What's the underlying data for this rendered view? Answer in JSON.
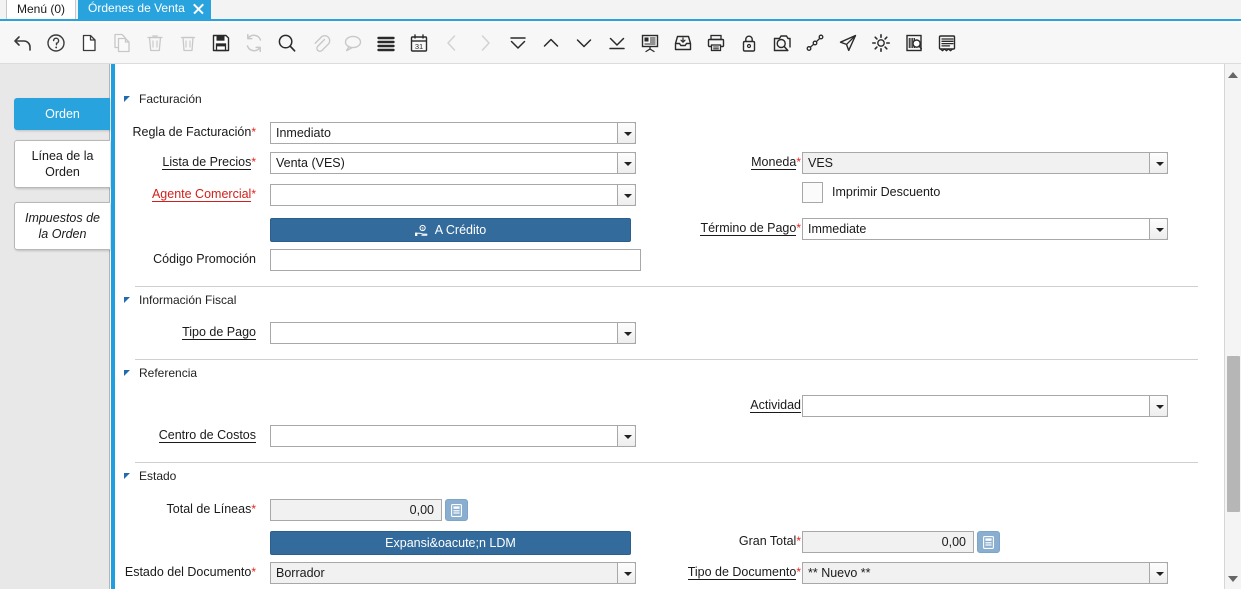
{
  "window": {
    "tabs": [
      {
        "label": "Menú (0)",
        "active": false,
        "closable": false
      },
      {
        "label": "Órdenes de Venta",
        "active": true,
        "closable": true
      }
    ]
  },
  "toolbar": {
    "items": [
      {
        "name": "undo-icon",
        "label": "Deshacer",
        "disabled": false
      },
      {
        "name": "help-icon",
        "label": "Ayuda",
        "disabled": false
      },
      {
        "name": "new-record-icon",
        "label": "Nuevo Registro",
        "disabled": false
      },
      {
        "name": "copy-record-icon",
        "label": "Copiar Registro",
        "disabled": true
      },
      {
        "name": "delete-record-icon",
        "label": "Eliminar Registro",
        "disabled": true
      },
      {
        "name": "delete-selection-icon",
        "label": "Eliminar Selección",
        "disabled": true
      },
      {
        "name": "save-icon",
        "label": "Guardar Cambios",
        "disabled": false
      },
      {
        "name": "refresh-icon",
        "label": "Refrescar",
        "disabled": true
      },
      {
        "name": "find-icon",
        "label": "Buscar",
        "disabled": false
      },
      {
        "name": "attachment-icon",
        "label": "Adjunto",
        "disabled": true
      },
      {
        "name": "chat-icon",
        "label": "Nota de Registro",
        "disabled": true
      },
      {
        "name": "grid-toggle-icon",
        "label": "Alternar Vista",
        "disabled": false
      },
      {
        "name": "calendar-icon",
        "label": "Calendario",
        "disabled": false
      },
      {
        "name": "previous-record-icon",
        "label": "Registro Anterior",
        "disabled": true
      },
      {
        "name": "next-record-icon",
        "label": "Registro Siguiente",
        "disabled": true
      },
      {
        "name": "first-record-icon",
        "label": "Primer Registro",
        "disabled": false
      },
      {
        "name": "up-record-icon",
        "label": "Registro Arriba",
        "disabled": false
      },
      {
        "name": "down-record-icon",
        "label": "Registro Abajo",
        "disabled": false
      },
      {
        "name": "last-record-icon",
        "label": "Último Registro",
        "disabled": false
      },
      {
        "name": "report-icon",
        "label": "Reporte",
        "disabled": false
      },
      {
        "name": "archive-icon",
        "label": "Archivo",
        "disabled": false
      },
      {
        "name": "print-icon",
        "label": "Imprimir",
        "disabled": false
      },
      {
        "name": "lock-icon",
        "label": "Bloquear Registro",
        "disabled": false
      },
      {
        "name": "zoom-across-icon",
        "label": "Zoom Across",
        "disabled": false
      },
      {
        "name": "workflow-icon",
        "label": "Flujo de Trabajo",
        "disabled": false
      },
      {
        "name": "send-icon",
        "label": "Enviar",
        "disabled": false
      },
      {
        "name": "settings-icon",
        "label": "Preferencias",
        "disabled": false
      },
      {
        "name": "audit-icon",
        "label": "Auditoría",
        "disabled": false
      },
      {
        "name": "document-view-icon",
        "label": "Ver Documento",
        "disabled": false
      }
    ]
  },
  "rail": {
    "tabs": [
      {
        "label": "Orden",
        "state": "selected"
      },
      {
        "label": "Línea de la Orden",
        "state": "normal"
      },
      {
        "label": "Impuestos de la Orden",
        "state": "italic"
      }
    ]
  },
  "form": {
    "sections": [
      {
        "title": "Facturación"
      },
      {
        "title": "Información Fiscal"
      },
      {
        "title": "Referencia"
      },
      {
        "title": "Estado"
      }
    ],
    "fields": {
      "regla_facturacion": {
        "label": "Regla de Facturación",
        "value": "Inmediato",
        "required": true,
        "readonly": false
      },
      "lista_precios": {
        "label": "Lista de Precios",
        "value": "Venta (VES)",
        "required": true,
        "readonly": false
      },
      "agente_comercial": {
        "label": "Agente Comercial",
        "value": "",
        "required": true,
        "readonly": false
      },
      "codigo_promocion": {
        "label": "Código Promoción",
        "value": "",
        "required": false,
        "readonly": false
      },
      "moneda": {
        "label": "Moneda",
        "value": "VES",
        "required": true,
        "readonly": true
      },
      "imprimir_descuento": {
        "label": "Imprimir Descuento",
        "checked": false
      },
      "termino_pago": {
        "label": "Término de Pago",
        "value": "Immediate",
        "required": true,
        "readonly": false
      },
      "tipo_pago": {
        "label": "Tipo de Pago",
        "value": "",
        "required": false,
        "readonly": false
      },
      "actividad": {
        "label": "Actividad",
        "value": "",
        "required": false,
        "readonly": false
      },
      "centro_costos": {
        "label": "Centro de Costos",
        "value": "",
        "required": false,
        "readonly": false
      },
      "total_lineas": {
        "label": "Total de Líneas",
        "value": "0,00",
        "required": true,
        "readonly": true
      },
      "gran_total": {
        "label": "Gran Total",
        "value": "0,00",
        "required": true,
        "readonly": true
      },
      "estado_documento": {
        "label": "Estado del Documento",
        "value": "Borrador",
        "required": true,
        "readonly": true
      },
      "tipo_documento": {
        "label": "Tipo de Documento",
        "value": "** Nuevo **",
        "required": true,
        "readonly": true
      }
    },
    "buttons": {
      "a_credito": {
        "label": "A Crédito",
        "icon": "hand-coin-icon"
      },
      "expansion_ldm": {
        "label": "Expansi&oacute;n LDM",
        "icon": ""
      }
    }
  },
  "colors": {
    "accent": "#29a3dd",
    "button": "#336b9c",
    "required": "#e8211b",
    "readonly_bg": "#f1f1f1",
    "rail_bg": "#e8e8e8"
  },
  "scrollbar": {
    "orientation": "vertical",
    "thumb_top_pct": 56,
    "thumb_height_pct": 32
  }
}
